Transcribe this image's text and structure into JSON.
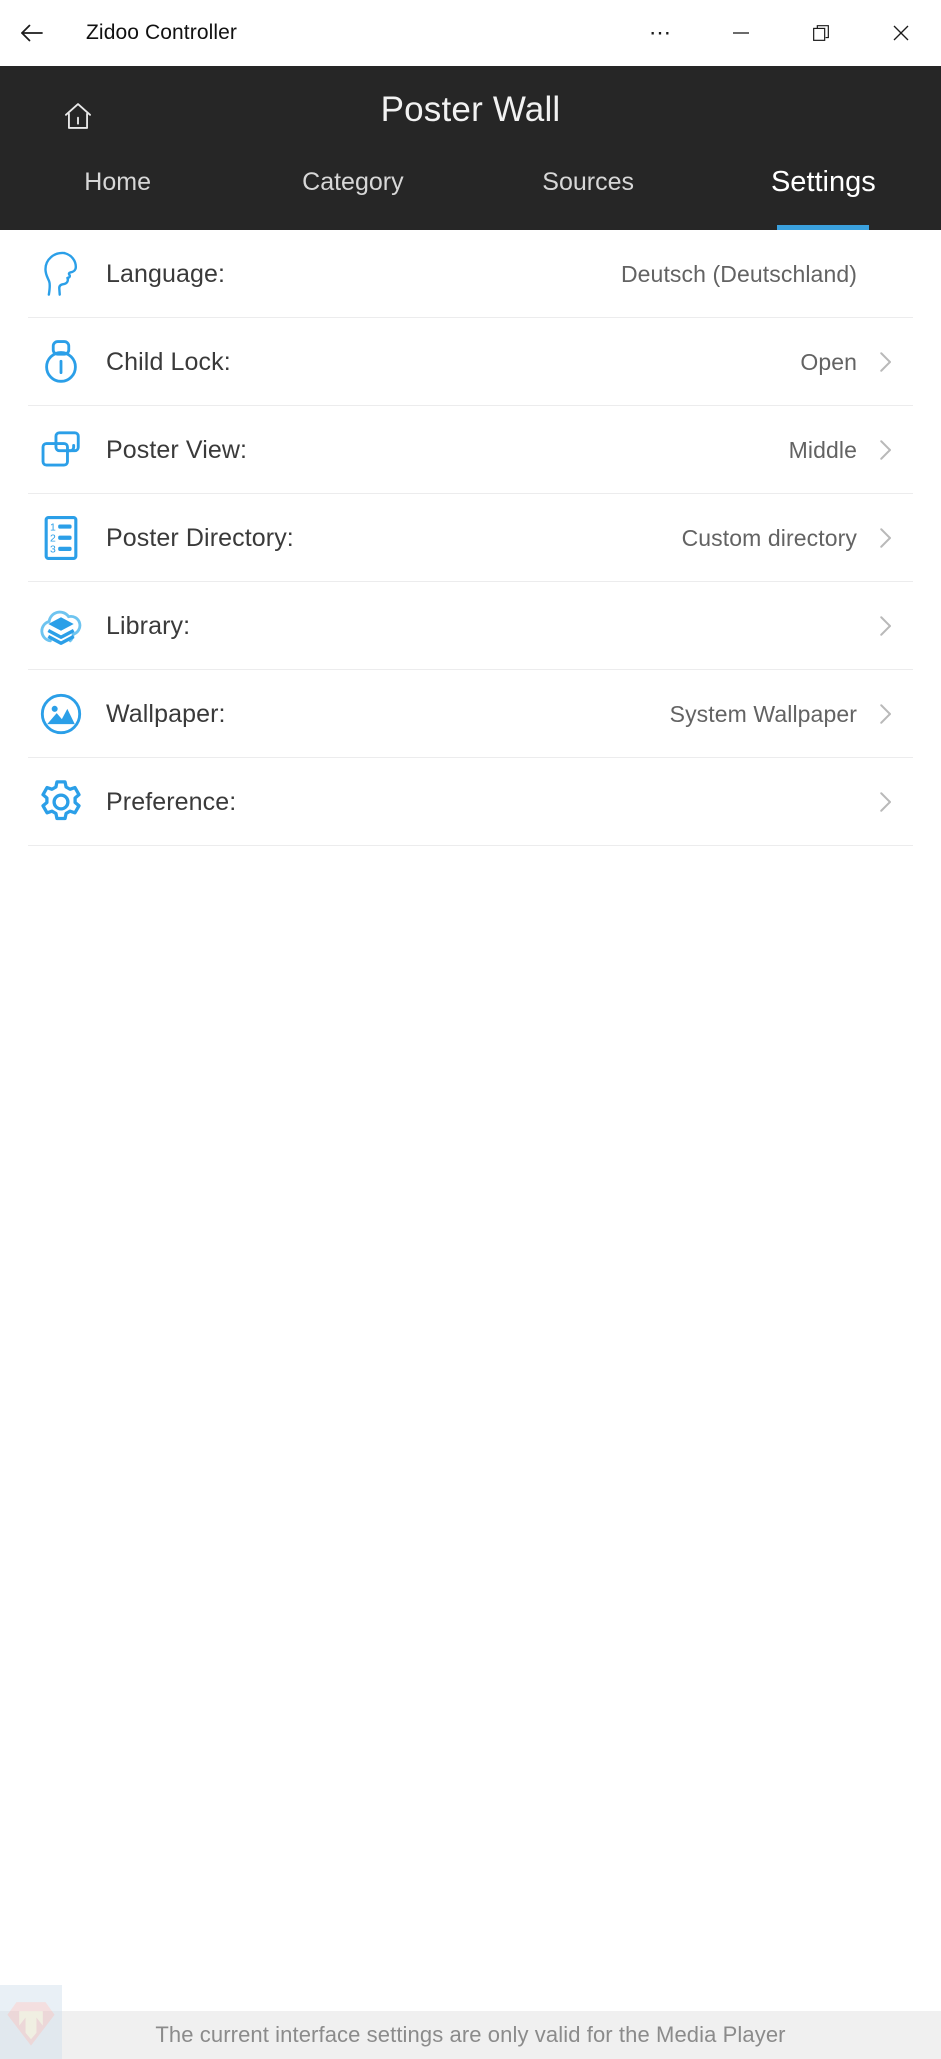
{
  "window": {
    "title": "Zidoo Controller",
    "back_icon": "back-arrow-icon",
    "more_icon": "more-options-icon",
    "minimize_icon": "minimize-icon",
    "maximize_icon": "restore-icon",
    "close_icon": "close-icon"
  },
  "header": {
    "title": "Poster Wall",
    "home_icon": "home-icon",
    "background_color": "#262626",
    "accent_color": "#3aa0dd"
  },
  "tabs": [
    {
      "label": "Home",
      "active": false
    },
    {
      "label": "Category",
      "active": false
    },
    {
      "label": "Sources",
      "active": false
    },
    {
      "label": "Settings",
      "active": true
    }
  ],
  "settings": {
    "rows": [
      {
        "label": "Language:",
        "value": "Deutsch (Deutschland)",
        "icon": "head-profile-icon",
        "chevron": false
      },
      {
        "label": "Child Lock:",
        "value": "Open",
        "icon": "padlock-icon",
        "chevron": true
      },
      {
        "label": "Poster View:",
        "value": "Middle",
        "icon": "overlapping-windows-icon",
        "chevron": true
      },
      {
        "label": "Poster Directory:",
        "value": "Custom directory",
        "icon": "numbered-list-icon",
        "chevron": true
      },
      {
        "label": "Library:",
        "value": "",
        "icon": "cloud-layers-icon",
        "chevron": true
      },
      {
        "label": "Wallpaper:",
        "value": "System Wallpaper",
        "icon": "image-circle-icon",
        "chevron": true
      },
      {
        "label": "Preference:",
        "value": "",
        "icon": "gear-icon",
        "chevron": true
      }
    ]
  },
  "statusbar": {
    "message": "The current interface settings are only valid for the Media Player",
    "watermark_icon": "diamond-m-logo-icon"
  }
}
